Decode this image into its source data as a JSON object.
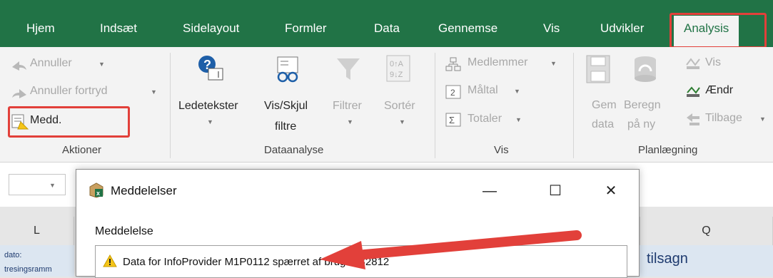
{
  "tabs": [
    "Hjem",
    "Indsæt",
    "Sidelayout",
    "Formler",
    "Data",
    "Gennemse",
    "Vis",
    "Udvikler"
  ],
  "active_tab": "Analysis",
  "groups": {
    "aktioner": {
      "label": "Aktioner",
      "undo": "Annuller",
      "redo": "Annuller fortryd",
      "messages": "Medd."
    },
    "dataanalyse": {
      "label": "Dataanalyse",
      "prompts": "Ledetekster",
      "show_hide": [
        "Vis/Skjul",
        "filtre"
      ],
      "filter": "Filtrer",
      "sort": "Sortér"
    },
    "vis": {
      "label": "Vis",
      "members": "Medlemmer",
      "measures": "Måltal",
      "totals": "Totaler"
    },
    "planlaegning": {
      "label": "Planlægning",
      "save": [
        "Gem",
        "data"
      ],
      "recalc": [
        "Beregn",
        "på ny"
      ],
      "show": "Vis",
      "change": "Ændr",
      "back": "Tilbage"
    }
  },
  "grid": {
    "columns": [
      "L",
      "Q"
    ],
    "cell_left": [
      "dato:",
      "tresingsramm"
    ],
    "cell_right": "tilsagn"
  },
  "dialog": {
    "title": "Meddelelser",
    "label": "Meddelelse",
    "message": "Data for InfoProvider M1P0112 spærret af bruger B2812"
  },
  "colors": {
    "ribbon_green": "#217346",
    "highlight": "#e2403a",
    "warning": "#f5c518"
  }
}
